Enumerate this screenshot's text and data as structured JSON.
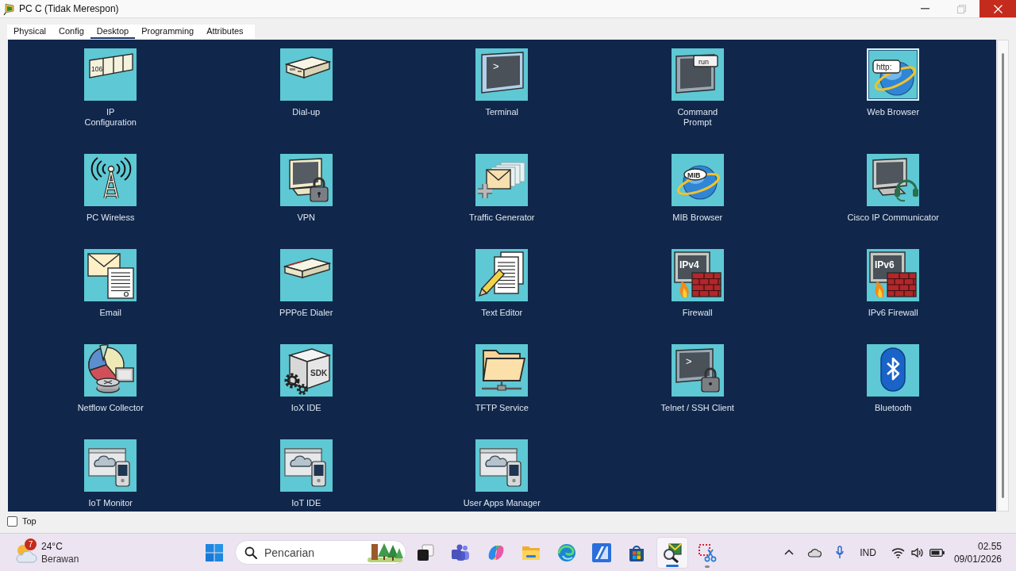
{
  "window": {
    "title": "PC C (Tidak Merespon)",
    "maximize_disabled": true
  },
  "tabs": [
    {
      "label": "Physical",
      "selected": false
    },
    {
      "label": "Config",
      "selected": false
    },
    {
      "label": "Desktop",
      "selected": true
    },
    {
      "label": "Programming",
      "selected": false
    },
    {
      "label": "Attributes",
      "selected": false
    }
  ],
  "desktop_apps": [
    {
      "label": "IP\nConfiguration",
      "kind": "ipconfig",
      "icon_text": "106",
      "selected": false
    },
    {
      "label": "Dial-up",
      "kind": "dialup",
      "selected": false
    },
    {
      "label": "Terminal",
      "kind": "terminal",
      "icon_text": ">",
      "selected": false
    },
    {
      "label": "Command\nPrompt",
      "kind": "cmd",
      "icon_text": "run",
      "selected": false
    },
    {
      "label": "Web Browser",
      "kind": "browser",
      "icon_text": "http:",
      "selected": true
    },
    {
      "label": "PC Wireless",
      "kind": "wireless",
      "selected": false
    },
    {
      "label": "VPN",
      "kind": "vpn",
      "selected": false
    },
    {
      "label": "Traffic Generator",
      "kind": "traffic",
      "selected": false
    },
    {
      "label": "MIB Browser",
      "kind": "mib",
      "icon_text": "MIB",
      "selected": false
    },
    {
      "label": "Cisco IP Communicator",
      "kind": "communicator",
      "selected": false
    },
    {
      "label": "Email",
      "kind": "email",
      "selected": false
    },
    {
      "label": "PPPoE Dialer",
      "kind": "pppoe",
      "selected": false
    },
    {
      "label": "Text Editor",
      "kind": "editor",
      "selected": false
    },
    {
      "label": "Firewall",
      "kind": "firewall",
      "icon_text": "IPv4",
      "selected": false
    },
    {
      "label": "IPv6 Firewall",
      "kind": "firewall",
      "icon_text": "IPv6",
      "selected": false
    },
    {
      "label": "Netflow Collector",
      "kind": "netflow",
      "selected": false
    },
    {
      "label": "IoX IDE",
      "kind": "sdk",
      "icon_text": "SDK",
      "selected": false
    },
    {
      "label": "TFTP Service",
      "kind": "tftp",
      "selected": false
    },
    {
      "label": "Telnet / SSH Client",
      "kind": "ssh",
      "icon_text": ">",
      "selected": false
    },
    {
      "label": "Bluetooth",
      "kind": "bluetooth",
      "selected": false
    },
    {
      "label": "IoT Monitor",
      "kind": "iot",
      "selected": false
    },
    {
      "label": "IoT IDE",
      "kind": "iot",
      "selected": false
    },
    {
      "label": "User Apps Manager",
      "kind": "iot",
      "selected": false
    }
  ],
  "top_checkbox": {
    "label": "Top",
    "checked": false
  },
  "taskbar": {
    "weather": {
      "badge": "7",
      "temperature": "24°C",
      "condition": "Berawan"
    },
    "search": {
      "placeholder": "Pencarian"
    },
    "apps": [
      {
        "kind": "taskview",
        "selected": false,
        "running": false
      },
      {
        "kind": "teams",
        "selected": false,
        "running": false
      },
      {
        "kind": "copilot",
        "selected": false,
        "running": false
      },
      {
        "kind": "explorer",
        "selected": false,
        "running": false
      },
      {
        "kind": "edge",
        "selected": false,
        "running": false
      },
      {
        "kind": "stripes",
        "selected": false,
        "running": false
      },
      {
        "kind": "store",
        "selected": false,
        "running": false
      },
      {
        "kind": "tracer",
        "selected": true,
        "running": true
      },
      {
        "kind": "snipping",
        "selected": false,
        "running": true
      }
    ],
    "tray": {
      "language": "IND",
      "time": "02.55",
      "date": "09/01/2026"
    }
  }
}
